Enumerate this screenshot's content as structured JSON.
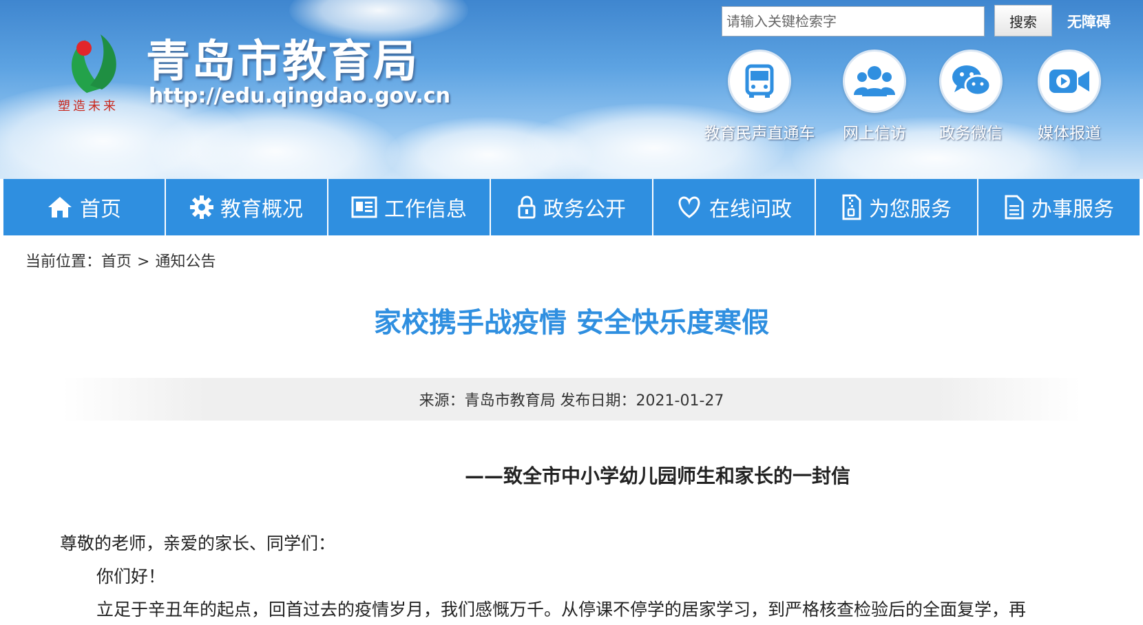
{
  "header": {
    "site_title": "青岛市教育局",
    "site_url": "http://edu.qingdao.gov.cn",
    "slogan": "塑造未来",
    "search": {
      "placeholder": "请输入关键检索字",
      "value": "",
      "button_label": "搜索"
    },
    "accessibility_label": "无障碍",
    "quick_links": [
      {
        "label": "教育民声直通车",
        "icon": "bus-icon"
      },
      {
        "label": "网上信访",
        "icon": "people-icon"
      },
      {
        "label": "政务微信",
        "icon": "wechat-icon"
      },
      {
        "label": "媒体报道",
        "icon": "video-icon"
      }
    ]
  },
  "nav": {
    "items": [
      {
        "label": "首页",
        "icon": "home-icon"
      },
      {
        "label": "教育概况",
        "icon": "gear-icon"
      },
      {
        "label": "工作信息",
        "icon": "newspaper-icon"
      },
      {
        "label": "政务公开",
        "icon": "lock-icon"
      },
      {
        "label": "在线问政",
        "icon": "heart-icon"
      },
      {
        "label": "为您服务",
        "icon": "document-icon"
      },
      {
        "label": "办事服务",
        "icon": "file-icon"
      }
    ]
  },
  "breadcrumb": {
    "prefix": "当前位置：",
    "home": "首页",
    "separator": ">",
    "current": "通知公告"
  },
  "article": {
    "title": "家校携手战疫情 安全快乐度寒假",
    "meta": "来源：青岛市教育局 发布日期：2021-01-27",
    "subtitle": "——致全市中小学幼儿园师生和家长的一封信",
    "salutation": "尊敬的老师，亲爱的家长、同学们：",
    "greeting": "你们好！",
    "paragraph1": "立足于辛丑年的起点，回首过去的疫情岁月，我们感慨万千。从停课不停学的居家学习，到严格核查检验后的全面复学，再"
  },
  "colors": {
    "nav_blue": "#2f8fe0",
    "title_blue": "#2f8fe0",
    "header_sky": "#5da3e2"
  }
}
